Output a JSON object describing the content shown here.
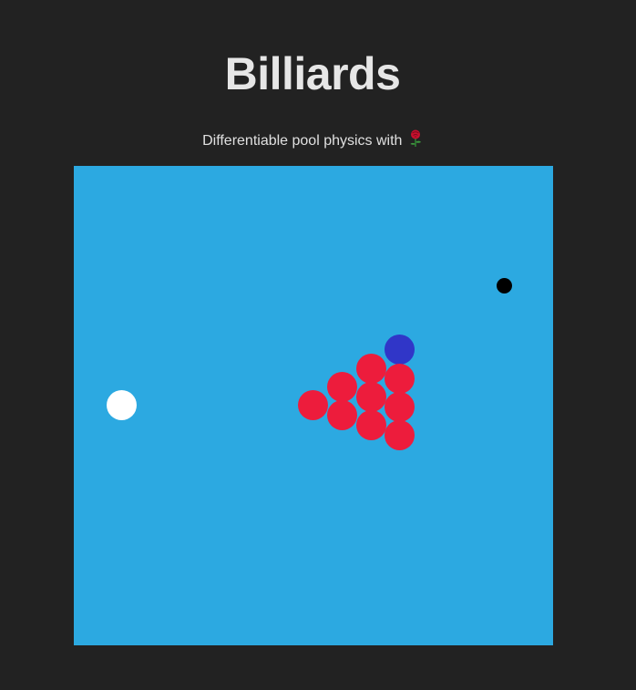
{
  "header": {
    "title": "Billiards",
    "subtitle": "Differentiable pool physics with"
  },
  "icons": {
    "subtitle_icon": "rose-icon"
  },
  "colors": {
    "background": "#222222",
    "table": "#2ca9e1",
    "cue_ball": "#ffffff",
    "object_ball": "#ed1c3c",
    "target_ball": "#3036c8",
    "hole": "#000000"
  }
}
